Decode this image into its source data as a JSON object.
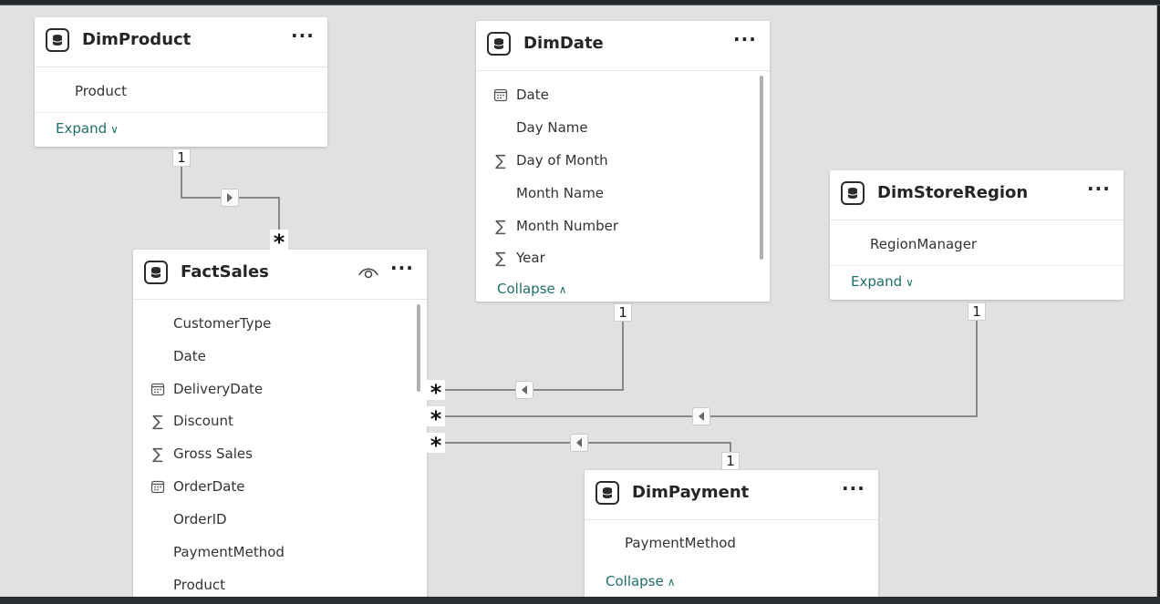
{
  "tables": {
    "dimproduct": {
      "title": "DimProduct",
      "fields": [
        {
          "label": "Product"
        }
      ],
      "toggle": "Expand"
    },
    "dimdate": {
      "title": "DimDate",
      "fields": [
        {
          "label": "Date",
          "icon": "calendar-icon"
        },
        {
          "label": "Day Name"
        },
        {
          "label": "Day of Month",
          "icon": "sigma-icon"
        },
        {
          "label": "Month Name"
        },
        {
          "label": "Month Number",
          "icon": "sigma-icon"
        },
        {
          "label": "Year",
          "icon": "sigma-icon"
        }
      ],
      "toggle": "Collapse"
    },
    "dimstoreregion": {
      "title": "DimStoreRegion",
      "fields": [
        {
          "label": "RegionManager"
        }
      ],
      "toggle": "Expand"
    },
    "factsales": {
      "title": "FactSales",
      "fields": [
        {
          "label": "CustomerType"
        },
        {
          "label": "Date"
        },
        {
          "label": "DeliveryDate",
          "icon": "calendar-icon"
        },
        {
          "label": "Discount",
          "icon": "sigma-icon"
        },
        {
          "label": "Gross Sales",
          "icon": "sigma-icon"
        },
        {
          "label": "OrderDate",
          "icon": "calendar-icon"
        },
        {
          "label": "OrderID"
        },
        {
          "label": "PaymentMethod"
        },
        {
          "label": "Product"
        }
      ]
    },
    "dimpayment": {
      "title": "DimPayment",
      "fields": [
        {
          "label": "PaymentMethod"
        }
      ],
      "toggle": "Collapse"
    }
  },
  "relationships": {
    "one_label": "1",
    "many_label": "*"
  },
  "icons": {
    "table": "database-icon",
    "more": "more-options-icon",
    "hide": "eye-icon",
    "calendar": "calendar-icon",
    "sum": "sigma-icon"
  },
  "colors": {
    "canvas": "#e2e1e0",
    "card": "#ffffff",
    "accent_link": "#1f6f6a",
    "line": "#6b6b6b"
  }
}
